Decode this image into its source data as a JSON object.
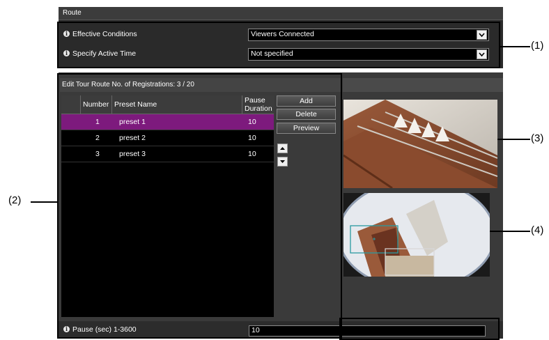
{
  "route": {
    "title": "Route",
    "effective_conditions": {
      "label": "Effective Conditions",
      "value": "Viewers Connected"
    },
    "active_time": {
      "label": "Specify Active Time",
      "value": "Not specified"
    }
  },
  "edit": {
    "header": "Edit Tour Route   No. of Registrations: 3 / 20",
    "columns": {
      "number": "Number",
      "preset": "Preset Name",
      "pause_1": "Pause",
      "pause_2": "Duration"
    },
    "rows": [
      {
        "number": "1",
        "preset": "preset 1",
        "pause": "10",
        "selected": true
      },
      {
        "number": "2",
        "preset": "preset 2",
        "pause": "10",
        "selected": false
      },
      {
        "number": "3",
        "preset": "preset 3",
        "pause": "10",
        "selected": false
      }
    ],
    "buttons": {
      "add": "Add",
      "delete": "Delete",
      "preview": "Preview"
    }
  },
  "pause": {
    "label": "Pause (sec) 1-3600",
    "value": "10"
  },
  "callouts": {
    "c1": "(1)",
    "c2": "(2)",
    "c3": "(3)",
    "c4": "(4)"
  },
  "icons": {
    "info": "info-icon",
    "dropdown": "chevron-down-icon",
    "up": "arrow-up-icon",
    "down": "arrow-down-icon"
  },
  "colors": {
    "selected_row": "#7d1a7d",
    "panel": "#3a3a3a",
    "overlay_box": "#2a9aa0"
  }
}
